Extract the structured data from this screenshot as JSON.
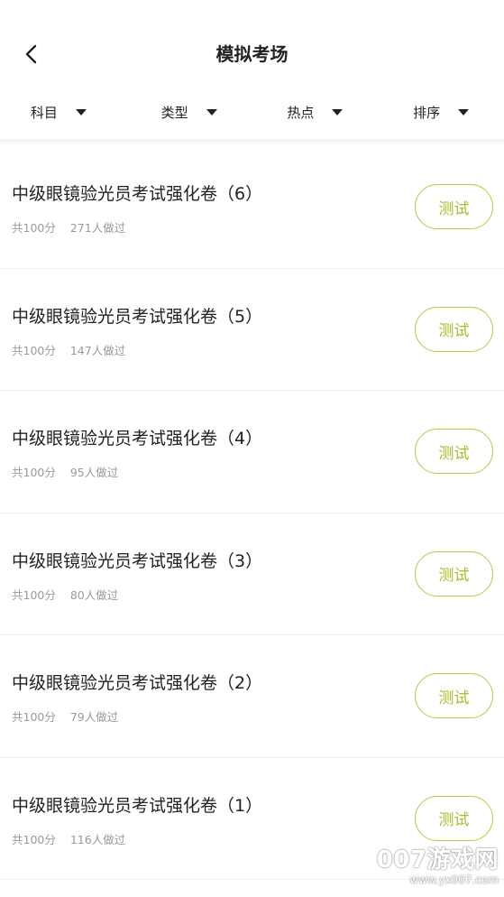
{
  "header": {
    "title": "模拟考场",
    "back_icon": "chevron-left-icon"
  },
  "filters": [
    {
      "label": "科目"
    },
    {
      "label": "类型"
    },
    {
      "label": "热点"
    },
    {
      "label": "排序"
    }
  ],
  "exams": [
    {
      "title": "中级眼镜验光员考试强化卷（6）",
      "score": "共100分",
      "takers": "271人做过",
      "button": "测试"
    },
    {
      "title": "中级眼镜验光员考试强化卷（5）",
      "score": "共100分",
      "takers": "147人做过",
      "button": "测试"
    },
    {
      "title": "中级眼镜验光员考试强化卷（4）",
      "score": "共100分",
      "takers": "95人做过",
      "button": "测试"
    },
    {
      "title": "中级眼镜验光员考试强化卷（3）",
      "score": "共100分",
      "takers": "80人做过",
      "button": "测试"
    },
    {
      "title": "中级眼镜验光员考试强化卷（2）",
      "score": "共100分",
      "takers": "79人做过",
      "button": "测试"
    },
    {
      "title": "中级眼镜验光员考试强化卷（1）",
      "score": "共100分",
      "takers": "116人做过",
      "button": "测试"
    }
  ],
  "watermark": {
    "main": "007游戏网",
    "sub": "www.yx007.com"
  },
  "colors": {
    "accent": "#b8cc3a",
    "text": "#222222",
    "muted": "#9a9a9a"
  }
}
